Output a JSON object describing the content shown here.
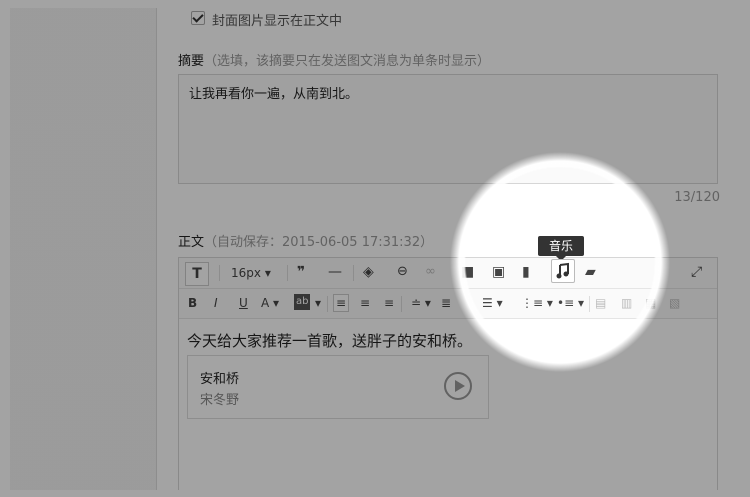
{
  "cover": {
    "checkbox_label": "封面图片显示在正文中",
    "checked": true
  },
  "summary": {
    "title": "摘要",
    "hint": "（选填，该摘要只在发送图文消息为单条时显示）",
    "text": "让我再看你一遍，从南到北。",
    "counter": "13/120"
  },
  "body_section": {
    "title": "正文",
    "autosave": "（自动保存：2015-06-05 17:31:32）"
  },
  "toolbar": {
    "font_size": "16px",
    "tooltip": "音乐",
    "icons_row1": [
      "text-icon",
      "font-size-select",
      "quote-icon",
      "hr-icon",
      "eraser-icon",
      "link-icon",
      "unlink-icon",
      "video-icon",
      "image-icon",
      "vote-chart-icon",
      "music-icon",
      "card-icon",
      "fullscreen-icon"
    ],
    "icons_row2": [
      "bold-icon",
      "italic-icon",
      "underline-icon",
      "font-color-icon",
      "bg-color-icon",
      "align-left-icon",
      "align-center-icon",
      "align-right-icon",
      "line-height-icon",
      "indent-icon",
      "ordered-list-icon",
      "unordered-list-icon",
      "float-left-icon",
      "float-none-icon",
      "float-right-icon",
      "center-block-icon"
    ]
  },
  "editor": {
    "content": "今天给大家推荐一首歌，送胖子的安和桥。",
    "music": {
      "title": "安和桥",
      "artist": "宋冬野"
    }
  }
}
